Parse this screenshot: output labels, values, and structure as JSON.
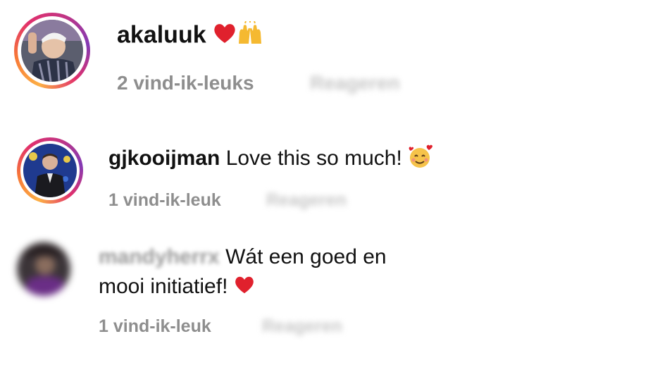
{
  "comments": [
    {
      "username": "akaluuk",
      "text": "",
      "emoji": "❤️🙌",
      "likes": "2 vind-ik-leuks",
      "reply": "Reageren"
    },
    {
      "username": "gjkooijman",
      "text": "Love this so much!",
      "emoji": "🥰",
      "likes": "1 vind-ik-leuk",
      "reply": "Reageren"
    },
    {
      "username": "mandyherrx",
      "text_line1": "Wát een goed en",
      "text_line2": "mooi initiatief!",
      "emoji": "❤️",
      "likes": "1 vind-ik-leuk",
      "reply": "Reageren"
    }
  ],
  "colors": {
    "meta_gray": "#8e8e8e",
    "story_ring_start": "#fcaf45",
    "story_ring_end": "#c13584",
    "heart_red": "#e0212d"
  },
  "icons": [
    "red-heart-icon",
    "raising-hands-icon",
    "smiling-face-with-hearts-icon"
  ]
}
